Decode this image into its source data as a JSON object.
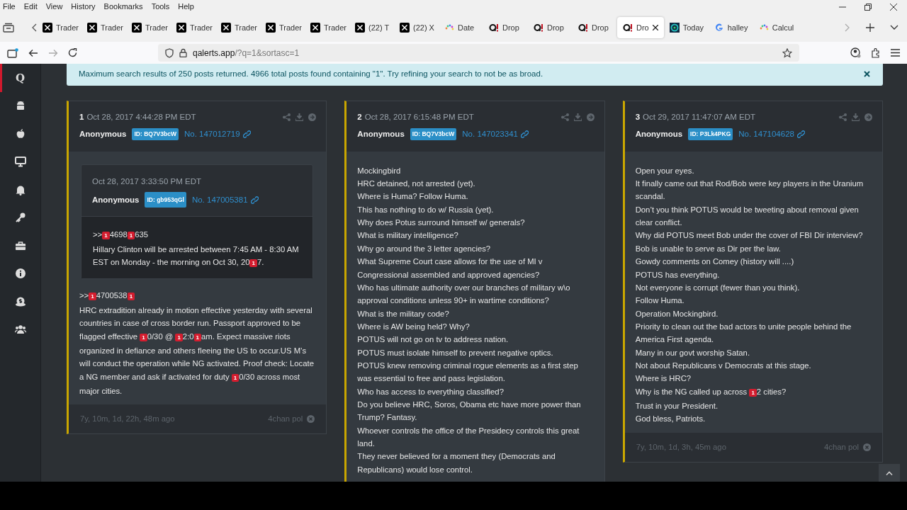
{
  "menu_bar": [
    "File",
    "Edit",
    "View",
    "History",
    "Bookmarks",
    "Tools",
    "Help"
  ],
  "tabs": [
    {
      "label": "Trader",
      "kind": "x",
      "selected": false
    },
    {
      "label": "Trader",
      "kind": "x",
      "selected": false
    },
    {
      "label": "Trader",
      "kind": "x",
      "selected": false
    },
    {
      "label": "Trader",
      "kind": "x",
      "selected": false
    },
    {
      "label": "Trader",
      "kind": "x",
      "selected": false
    },
    {
      "label": "Trader",
      "kind": "x",
      "selected": false
    },
    {
      "label": "Trader",
      "kind": "x",
      "selected": false
    },
    {
      "label": "(22) T",
      "kind": "x",
      "selected": false
    },
    {
      "label": "(22) X",
      "kind": "x",
      "selected": false
    },
    {
      "label": "Date",
      "kind": "dots",
      "selected": false
    },
    {
      "label": "Drop",
      "kind": "q",
      "selected": false
    },
    {
      "label": "Drop",
      "kind": "q",
      "selected": false
    },
    {
      "label": "Drop",
      "kind": "q",
      "selected": false
    },
    {
      "label": "Dro",
      "kind": "q",
      "selected": true
    },
    {
      "label": "Today",
      "kind": "swirl",
      "selected": false
    },
    {
      "label": "halley",
      "kind": "g",
      "selected": false
    },
    {
      "label": "Calcul",
      "kind": "dots",
      "selected": false
    }
  ],
  "address_bar": {
    "host": "qalerts.app",
    "path": "/?q=1&sortasc=1"
  },
  "sidebar": {
    "items": [
      {
        "kind": "letter",
        "label": "Q",
        "selected": true
      },
      {
        "kind": "robot",
        "selected": false
      },
      {
        "kind": "apple",
        "selected": false
      },
      {
        "kind": "monitor",
        "selected": false
      },
      {
        "kind": "bell",
        "selected": false
      },
      {
        "kind": "key",
        "selected": false
      },
      {
        "kind": "toolbox",
        "selected": false
      },
      {
        "kind": "info",
        "selected": false
      },
      {
        "kind": "coin",
        "selected": false
      },
      {
        "kind": "users",
        "selected": false
      }
    ]
  },
  "alert": {
    "text": "Maximum search results of 250 posts returned. 4966 total posts found containing \"1\". Try refining your search to not be as broad."
  },
  "posts": [
    {
      "number": "1",
      "date": "Oct 28, 2017 4:44:28 PM EDT",
      "author": "Anonymous",
      "id": "ID: BQ7V3bcW",
      "post_no": "No. 147012719",
      "quote": {
        "date": "Oct 28, 2017 3:33:50 PM EDT",
        "author": "Anonymous",
        "id": "ID: gb953qGl",
        "post_no": "No. 147005381",
        "lines": [
          [
            ">>",
            {
              "hit": "1"
            },
            "4698",
            {
              "hit": "1"
            },
            "635"
          ],
          [
            "Hillary Clinton will be arrested between 7:45 AM - 8:30 AM EST on Monday - the morning on Oct 30, 20",
            {
              "hit": "1"
            },
            "7."
          ]
        ]
      },
      "body": [
        [
          ">>",
          {
            "hit": "1"
          },
          "4700538",
          {
            "hit": "1"
          }
        ],
        [
          "HRC extradition already in motion effective yesterday with several countries in case of cross border run. Passport approved to be flagged effective ",
          {
            "hit": "1"
          },
          "0/30 @ ",
          {
            "hit": "1"
          },
          "2:0",
          {
            "hit": "1"
          },
          "am. Expect massive riots organized in defiance and others fleeing the US to occur.US M’s will conduct the operation while NG activated. Proof check: Locate a NG member and ask if activated for duty ",
          {
            "hit": "1"
          },
          "0/30 across most major cities."
        ]
      ],
      "age": "7y, 10m, 1d, 22h, 48m ago",
      "source": "4chan pol"
    },
    {
      "number": "2",
      "date": "Oct 28, 2017 6:15:48 PM EDT",
      "author": "Anonymous",
      "id": "ID: BQ7V3bcW",
      "post_no": "No. 147023341",
      "body": [
        [
          "Mockingbird"
        ],
        [
          "HRC detained, not arrested (yet)."
        ],
        [
          "Where is Huma? Follow Huma."
        ],
        [
          "This has nothing to do w/ Russia (yet)."
        ],
        [
          "Why does Potus surround himself w/ generals?"
        ],
        [
          "What is military intelligence?"
        ],
        [
          "Why go around the 3 letter agencies?"
        ],
        [
          "What Supreme Court case allows for the use of MI v Congressional assembled and approved agencies?"
        ],
        [
          "Who has ultimate authority over our branches of military w\\o approval conditions unless 90+ in wartime conditions?"
        ],
        [
          "What is the military code?"
        ],
        [
          "Where is AW being held? Why?"
        ],
        [
          "POTUS will not go on tv to address nation."
        ],
        [
          "POTUS must isolate himself to prevent negative optics."
        ],
        [
          "POTUS knew removing criminal rogue elements as a first step was essential to free and pass legislation."
        ],
        [
          "Who has access to everything classified?"
        ],
        [
          "Do you believe HRC, Soros, Obama etc have more power than Trump? Fantasy."
        ],
        [
          "Whoever controls the office of the Presidecy controls this great land."
        ],
        [
          "They never believed for a moment they (Democrats and Republicans) would lose control."
        ]
      ]
    },
    {
      "number": "3",
      "date": "Oct 29, 2017 11:47:07 AM EDT",
      "author": "Anonymous",
      "id": "ID: P3Lk4PKG",
      "post_no": "No. 147104628",
      "body": [
        [
          "Open your eyes."
        ],
        [
          "It finally came out that Rod/Bob were key players in the Uranium scandal."
        ],
        [
          "Don’t you think POTUS would be tweeting about removal given clear conflict."
        ],
        [
          "Why did POTUS meet Bob under the cover of FBI Dir interview?"
        ],
        [
          "Bob is unable to serve as Dir per the law."
        ],
        [
          "Gowdy comments on Comey (history will ....)"
        ],
        [
          "POTUS has everything."
        ],
        [
          "Not everyone is corrupt (fewer than you think)."
        ],
        [
          "Follow Huma."
        ],
        [
          "Operation Mockingbird."
        ],
        [
          "Priority to clean out the bad actors to unite people behind the America First agenda."
        ],
        [
          "Many in our govt worship Satan."
        ],
        [
          "Not about Republicans v Democrats at this stage."
        ],
        [
          "Where is HRC?"
        ],
        [
          "Why is the NG called up across ",
          {
            "hit": "1"
          },
          "2 cities?"
        ],
        [
          "Trust in your President."
        ],
        [
          "God bless, Patriots."
        ]
      ],
      "age": "7y, 10m, 1d, 3h, 45m ago",
      "source": "4chan pol"
    }
  ]
}
